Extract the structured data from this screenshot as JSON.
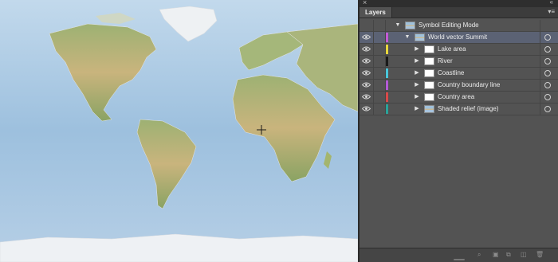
{
  "panel": {
    "tab_label": "Layers",
    "close_glyph": "×",
    "menu_glyph": "▾≡",
    "grip_glyph": "«"
  },
  "layers": [
    {
      "name": "Symbol Editing Mode",
      "level": 0,
      "expanded": true,
      "color": null,
      "thumb": "image",
      "visible_toggle": false,
      "selected": false,
      "target": false
    },
    {
      "name": "World vector Summit",
      "level": 1,
      "expanded": true,
      "color": "#c25ad6",
      "thumb": "image",
      "visible_toggle": true,
      "selected": true,
      "target": true
    },
    {
      "name": "Lake area",
      "level": 2,
      "expanded": false,
      "color": "#e7d63d",
      "thumb": "blank",
      "visible_toggle": true,
      "selected": false,
      "target": true
    },
    {
      "name": "River",
      "level": 2,
      "expanded": false,
      "color": "#1a1a1a",
      "thumb": "blank",
      "visible_toggle": true,
      "selected": false,
      "target": true
    },
    {
      "name": "Coastline",
      "level": 2,
      "expanded": false,
      "color": "#49c6da",
      "thumb": "coast",
      "visible_toggle": true,
      "selected": false,
      "target": true
    },
    {
      "name": "Country boundary line",
      "level": 2,
      "expanded": false,
      "color": "#b35ad6",
      "thumb": "blank",
      "visible_toggle": true,
      "selected": false,
      "target": true
    },
    {
      "name": "Country area",
      "level": 2,
      "expanded": false,
      "color": "#d94a4a",
      "thumb": "blank",
      "visible_toggle": true,
      "selected": false,
      "target": true
    },
    {
      "name": "Shaded relief (image)",
      "level": 2,
      "expanded": false,
      "color": "#2aa39a",
      "thumb": "image",
      "visible_toggle": true,
      "selected": false,
      "target": true
    }
  ],
  "footer_icons": [
    "search-icon",
    "make-clipping-mask-icon",
    "new-sublayer-icon",
    "new-layer-icon",
    "trash-icon"
  ],
  "map": {
    "ocean_color": "#a9c9e2",
    "land_color": "#b9b878",
    "cursor": "crosshair"
  }
}
